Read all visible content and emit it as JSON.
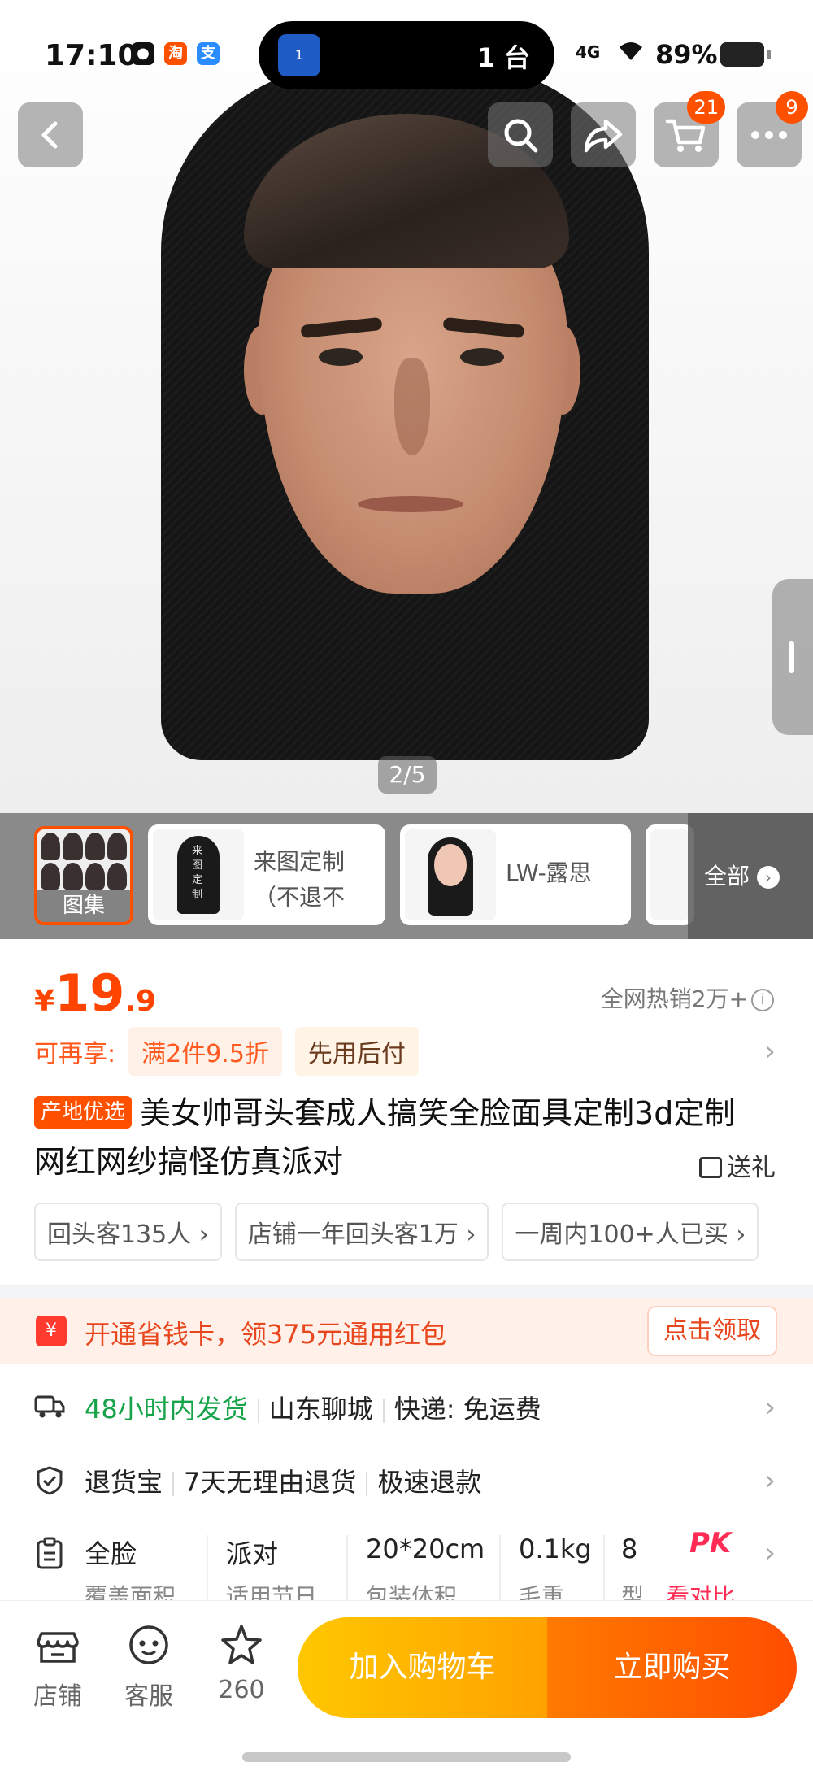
{
  "status_bar": {
    "time": "17:10",
    "island_text": "1 台",
    "island_badge": "1",
    "signal": "4G",
    "battery": "89%"
  },
  "gallery": {
    "pager": "2/5"
  },
  "cart_badge": "21",
  "more_badge": "9",
  "sku": {
    "first_label": "图集",
    "item2_line1": "来图定制",
    "item2_line2": "（不退不",
    "item2_thumb_text": "来图定制",
    "item3_label": "LW-露思",
    "all_label": "全部"
  },
  "product": {
    "price_currency": "¥",
    "price_int": "19",
    "price_dec": ".9",
    "hot_text": "全网热销2万+",
    "promo_label": "可再享:",
    "promo_tag1": "满2件9.5折",
    "promo_tag2": "先用后付",
    "origin_badge": "产地优选",
    "title": "美女帅哥头套成人搞笑全脸面具定制3d定制网红网纱搞怪仿真派对",
    "gift": "送礼",
    "chips": [
      "回头客135人 ›",
      "店铺一年回头客1万 ›",
      "一周内100+人已买 ›"
    ]
  },
  "packet": {
    "text": "开通省钱卡，领375元通用红包",
    "button": "点击领取"
  },
  "service": {
    "shipping_green": "48小时内发货",
    "shipping_place": "山东聊城",
    "shipping_express": "快递: 免运费",
    "returns_a": "退货宝",
    "returns_b": "7天无理由退货",
    "returns_c": "极速退款",
    "specs": [
      {
        "value": "全脸",
        "label": "覆盖面积"
      },
      {
        "value": "派对",
        "label": "适用节日"
      },
      {
        "value": "20*20cm",
        "label": "包装体积"
      },
      {
        "value": "0.1kg",
        "label": "毛重"
      },
      {
        "value": "8",
        "label": "型"
      }
    ],
    "pk": "PK",
    "pk_sub": "看对比"
  },
  "bottom": {
    "store": "店铺",
    "service": "客服",
    "fav_count": "260",
    "add_cart": "加入购物车",
    "buy_now": "立即购买"
  },
  "colors": {
    "accent": "#ff5000",
    "price": "#ff4400",
    "green": "#17a34a"
  }
}
